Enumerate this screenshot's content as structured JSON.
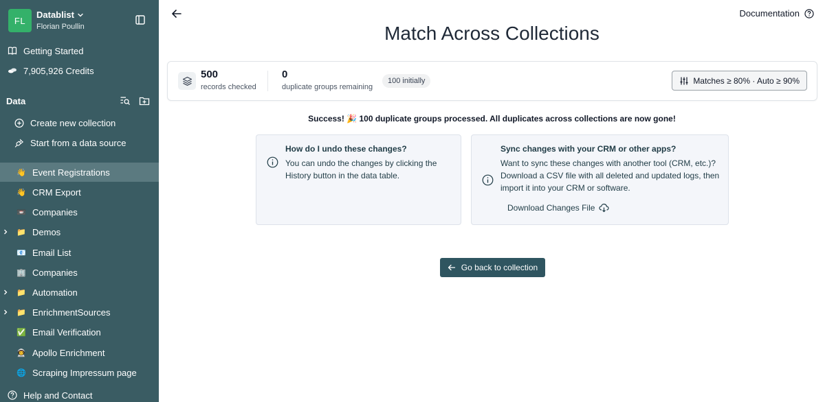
{
  "sidebar": {
    "avatar_initials": "FL",
    "workspace_name": "Datablist",
    "user_name": "Florian Poullin",
    "top_items": [
      {
        "label": "Getting Started",
        "icon": "book-icon"
      },
      {
        "label": "7,905,926 Credits",
        "icon": "coins-icon"
      }
    ],
    "data_heading": "Data",
    "actions": [
      {
        "label": "Create new collection",
        "icon": "plus-circle-icon"
      },
      {
        "label": "Start from a data source",
        "icon": "plug-icon"
      }
    ],
    "collections": [
      {
        "label": "Event Registrations",
        "emoji": "👋",
        "active": true,
        "folder": false
      },
      {
        "label": "CRM Export",
        "emoji": "👋",
        "active": false,
        "folder": false
      },
      {
        "label": "Companies",
        "emoji": "📼",
        "active": false,
        "folder": false
      },
      {
        "label": "Demos",
        "emoji": "📁",
        "active": false,
        "folder": true
      },
      {
        "label": "Email List",
        "emoji": "📧",
        "active": false,
        "folder": false
      },
      {
        "label": "Companies",
        "emoji": "🏢",
        "active": false,
        "folder": false
      },
      {
        "label": "Automation",
        "emoji": "📁",
        "active": false,
        "folder": true
      },
      {
        "label": "EnrichmentSources",
        "emoji": "📁",
        "active": false,
        "folder": true
      },
      {
        "label": "Email Verification",
        "emoji": "✅",
        "active": false,
        "folder": false
      },
      {
        "label": "Apollo Enrichment",
        "emoji": "👨‍🚀",
        "active": false,
        "folder": false
      },
      {
        "label": "Scraping Impressum page",
        "emoji": "🌐",
        "active": false,
        "folder": false
      }
    ],
    "help_label": "Help and Contact"
  },
  "header": {
    "documentation_label": "Documentation",
    "title": "Match Across Collections"
  },
  "stats": {
    "records_checked": "500",
    "records_checked_label": "records checked",
    "groups_remaining": "0",
    "groups_remaining_label": "duplicate groups remaining",
    "initially_pill": "100 initially",
    "matches_button": "Matches ≥ 80% · Auto ≥ 90%"
  },
  "success_message": "Success! 🎉 100 duplicate groups processed. All duplicates across collections are now gone!",
  "undo_card": {
    "title": "How do I undo these changes?",
    "body": "You can undo the changes by clicking the History button in the data table."
  },
  "sync_card": {
    "title": "Sync changes with your CRM or other apps?",
    "body": "Want to sync these changes with another tool (CRM, etc.)? Download a CSV file with all deleted and updated logs, then import it into your CRM or software.",
    "download_label": "Download Changes File"
  },
  "go_back_button": "Go back to collection",
  "colors": {
    "sidebar_bg": "#3a5c63",
    "sidebar_active": "#5b7a80",
    "avatar_bg": "#34b16a",
    "primary_button": "#2f5560",
    "card_bg": "#f4f6fa"
  }
}
